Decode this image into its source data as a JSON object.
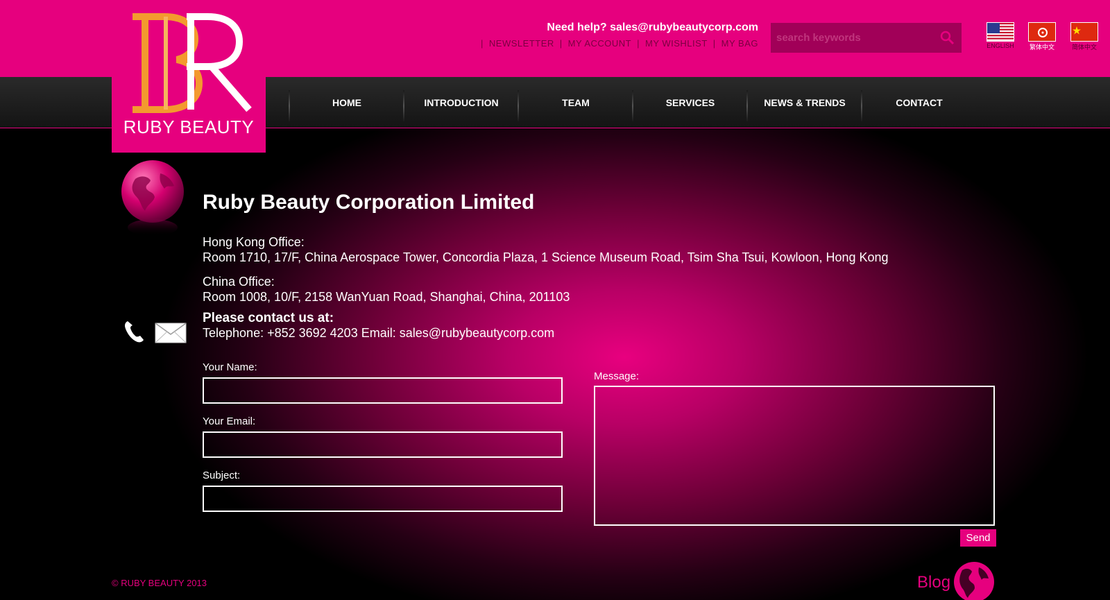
{
  "brand": {
    "name": "RUBY BEAUTY",
    "colors": {
      "primary": "#e6007e",
      "accent": "#f39a2e",
      "nav_bg": "#1c1c1c"
    }
  },
  "header": {
    "help_text": "Need help? sales@rubybeautycorp.com",
    "links": [
      "NEWSLETTER",
      "MY ACCOUNT",
      "MY WISHLIST",
      "MY BAG"
    ],
    "search": {
      "placeholder": "search keywords",
      "icon": "search-icon"
    },
    "languages": [
      {
        "label": "ENGLISH",
        "flag": "us-flag-icon"
      },
      {
        "label": "繁体中文",
        "flag": "hk-flag-icon"
      },
      {
        "label": "简体中文",
        "flag": "cn-flag-icon"
      }
    ]
  },
  "nav": {
    "items": [
      "HOME",
      "INTRODUCTION",
      "TEAM",
      "SERVICES",
      "NEWS & TRENDS",
      "CONTACT"
    ]
  },
  "main": {
    "company": "Ruby Beauty Corporation Limited",
    "hk_office": {
      "title": "Hong Kong Office:",
      "address": "Room 1710, 17/F, China Aerospace Tower, Concordia Plaza, 1 Science Museum Road, Tsim Sha Tsui, Kowloon, Hong Kong"
    },
    "cn_office": {
      "title": "China Office:",
      "address": "Room 1008, 10/F, 2158 WanYuan Road, Shanghai, China, 201103"
    },
    "contact_heading": "Please contact us at:",
    "contact_line": "Telephone: +852 3692 4203 Email: sales@rubybeautycorp.com"
  },
  "form": {
    "name_label": "Your Name:",
    "email_label": "Your Email:",
    "subject_label": "Subject:",
    "message_label": "Message:",
    "send_label": "Send",
    "name_value": "",
    "email_value": "",
    "subject_value": "",
    "message_value": ""
  },
  "footer": {
    "copyright": "© RUBY BEAUTY 2013",
    "blog": "Blog"
  }
}
